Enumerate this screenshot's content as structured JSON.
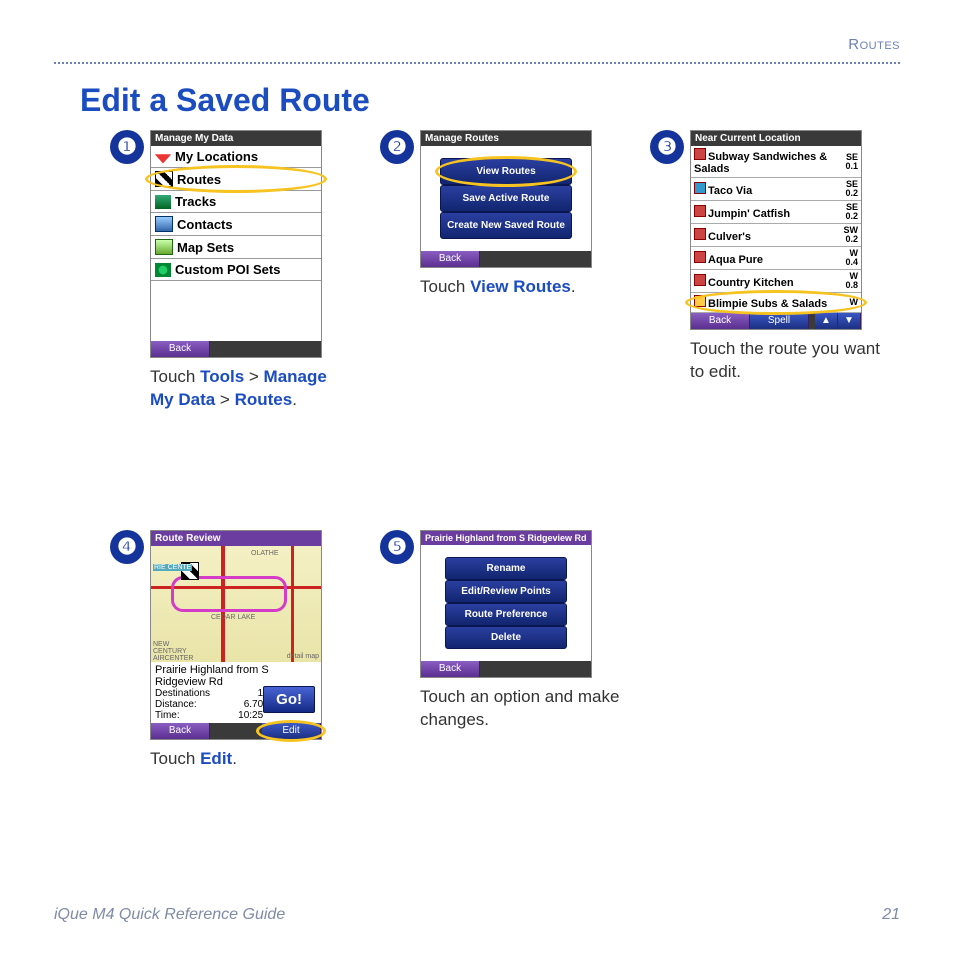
{
  "header": {
    "section": "Routes"
  },
  "title": "Edit a Saved Route",
  "steps": [
    {
      "num": "❶",
      "screen": {
        "topbar": "Manage My Data",
        "menu": [
          "My Locations",
          "Routes",
          "Tracks",
          "Contacts",
          "Map Sets",
          "Custom POI Sets"
        ],
        "highlighted": "Routes",
        "footer": {
          "back": "Back"
        }
      },
      "caption": {
        "pre": "Touch ",
        "b1": "Tools",
        "mid1": " > ",
        "b2": "Manage My Data",
        "mid2": " > ",
        "b3": "Routes",
        "post": "."
      }
    },
    {
      "num": "❷",
      "screen": {
        "topbar": "Manage Routes",
        "buttons": [
          "View Routes",
          "Save Active Route",
          "Create New Saved Route"
        ],
        "highlighted": "View Routes",
        "footer": {
          "back": "Back"
        }
      },
      "caption": {
        "pre": "Touch ",
        "b1": "View Routes",
        "post": "."
      }
    },
    {
      "num": "❸",
      "screen": {
        "topbar": "Near Current Location",
        "pois": [
          {
            "name": "Subway Sandwiches & Salads",
            "dir": "SE",
            "dist": "0.1"
          },
          {
            "name": "Taco Via",
            "dir": "SE",
            "dist": "0.2"
          },
          {
            "name": "Jumpin' Catfish",
            "dir": "SE",
            "dist": "0.2"
          },
          {
            "name": "Culver's",
            "dir": "SW",
            "dist": "0.2"
          },
          {
            "name": "Aqua Pure",
            "dir": "W",
            "dist": "0.4"
          },
          {
            "name": "Country Kitchen",
            "dir": "W",
            "dist": "0.8"
          },
          {
            "name": "Blimpie Subs & Salads",
            "dir": "W",
            "dist": ""
          }
        ],
        "highlighted_index": 6,
        "footer": {
          "back": "Back",
          "spell": "Spell"
        }
      },
      "caption": {
        "plain": "Touch the route you want to edit."
      }
    },
    {
      "num": "❹",
      "screen": {
        "topbar": "Route Review",
        "map_labels": [
          "OLATHE",
          "RIE CENTE",
          "CEDAR LAKE",
          "NEW CENTURY AIRCENTER",
          "detail map"
        ],
        "route_name": "Prairie Highland from S Ridgeview Rd",
        "details": {
          "Destinations": "1",
          "Distance:": "6.70",
          "Time:": "10:25"
        },
        "go": "Go!",
        "footer": {
          "back": "Back",
          "edit": "Edit"
        },
        "highlighted": "Edit"
      },
      "caption": {
        "pre": "Touch ",
        "b1": "Edit",
        "post": "."
      }
    },
    {
      "num": "❺",
      "screen": {
        "topbar": "Prairie Highland from S Ridgeview Rd",
        "buttons": [
          "Rename",
          "Edit/Review Points",
          "Route Preference",
          "Delete"
        ],
        "footer": {
          "back": "Back"
        }
      },
      "caption": {
        "plain": "Touch an option and make changes."
      }
    }
  ],
  "footer": {
    "guide": "iQue M4 Quick Reference Guide",
    "page": "21"
  }
}
